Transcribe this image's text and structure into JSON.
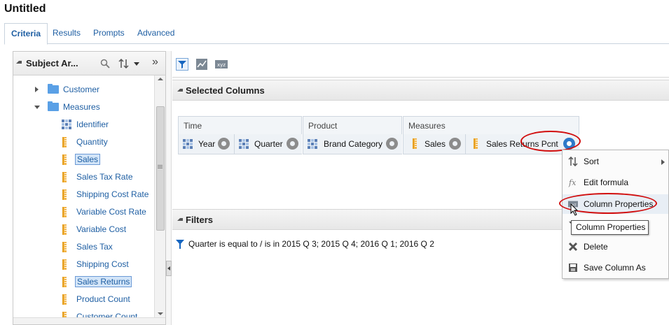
{
  "page": {
    "title": "Untitled"
  },
  "tabs": [
    "Criteria",
    "Results",
    "Prompts",
    "Advanced"
  ],
  "left_pane": {
    "title": "Subject Ar...",
    "tree": [
      {
        "label": "Customer",
        "type": "folder",
        "expanded": false,
        "selected": false
      },
      {
        "label": "Measures",
        "type": "folder",
        "expanded": true,
        "selected": false
      },
      {
        "label": "Identifier",
        "type": "attribute",
        "selected": false
      },
      {
        "label": "Quantity",
        "type": "measure",
        "selected": false
      },
      {
        "label": "Sales",
        "type": "measure",
        "selected": true
      },
      {
        "label": "Sales Tax Rate",
        "type": "measure",
        "selected": false
      },
      {
        "label": "Shipping Cost Rate",
        "type": "measure",
        "selected": false
      },
      {
        "label": "Variable Cost Rate",
        "type": "measure",
        "selected": false
      },
      {
        "label": "Variable Cost",
        "type": "measure",
        "selected": false
      },
      {
        "label": "Sales Tax",
        "type": "measure",
        "selected": false
      },
      {
        "label": "Shipping Cost",
        "type": "measure",
        "selected": false
      },
      {
        "label": "Sales Returns",
        "type": "measure",
        "selected": true
      },
      {
        "label": "Product Count",
        "type": "measure",
        "selected": false
      },
      {
        "label": "Customer Count",
        "type": "measure",
        "selected": false
      }
    ]
  },
  "toolbar": {
    "icons": [
      "filter-icon",
      "sparkline-icon",
      "xyz-icon"
    ]
  },
  "selected_columns": {
    "title": "Selected Columns",
    "groups": [
      {
        "name": "Time",
        "columns": [
          {
            "label": "Year",
            "icon": "attribute"
          },
          {
            "label": "Quarter",
            "icon": "attribute"
          }
        ]
      },
      {
        "name": "Product",
        "columns": [
          {
            "label": "Brand Category",
            "icon": "attribute"
          }
        ]
      },
      {
        "name": "Measures",
        "columns": [
          {
            "label": "Sales",
            "icon": "measure"
          },
          {
            "label": "Sales Returns Pcnt",
            "icon": "measure"
          }
        ]
      }
    ]
  },
  "filters": {
    "title": "Filters",
    "text": "Quarter is equal to / is in  2015 Q 3; 2015 Q 4; 2016 Q 1; 2016 Q 2"
  },
  "context_menu": {
    "items": [
      {
        "label": "Sort",
        "icon": "sort-icon",
        "submenu": true
      },
      {
        "label": "Edit formula",
        "icon": "fx-icon",
        "submenu": false
      },
      {
        "label": "Column Properties",
        "icon": "column-properties-icon",
        "submenu": false,
        "highlighted": true
      },
      {
        "label": "",
        "icon": "filter-icon",
        "submenu": false
      },
      {
        "label": "Delete",
        "icon": "delete-icon",
        "submenu": false
      },
      {
        "label": "Save Column As",
        "icon": "save-icon",
        "submenu": false
      }
    ]
  },
  "tooltip": {
    "text": "Column Properties"
  },
  "colors": {
    "link": "#1f5fa3",
    "highlight_ring": "#d10d0d",
    "gear_active": "#2e79c9"
  }
}
